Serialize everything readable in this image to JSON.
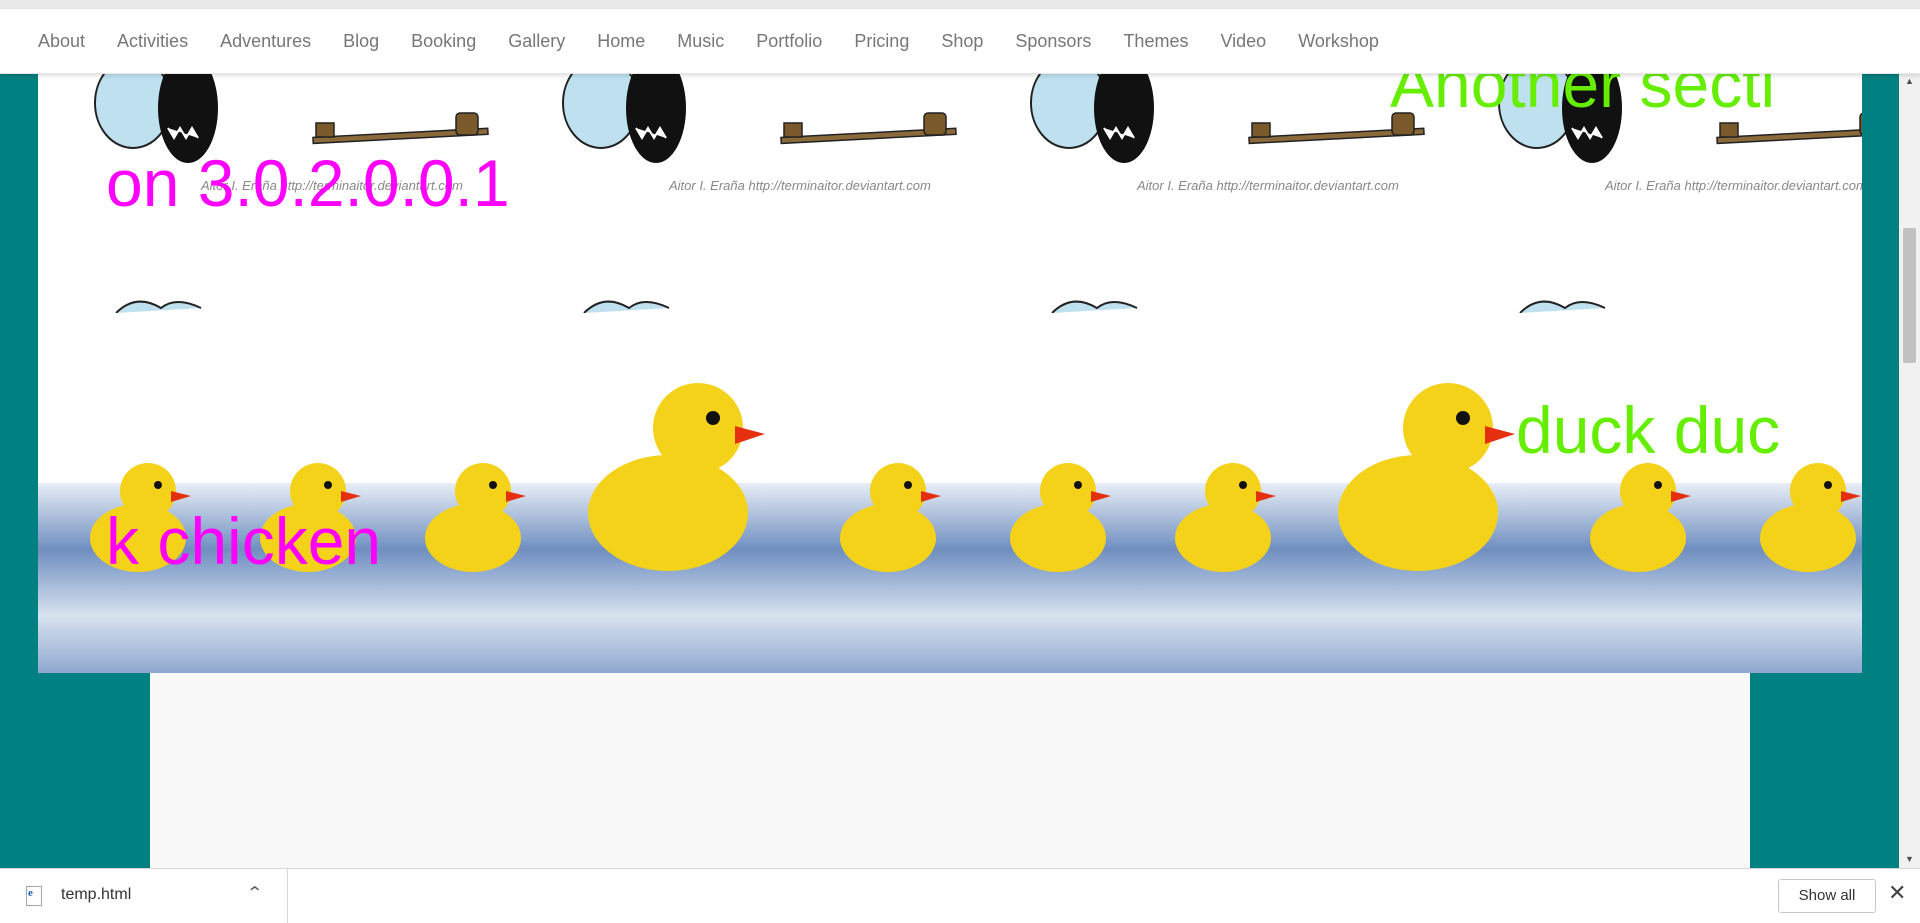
{
  "nav": {
    "items": [
      "About",
      "Activities",
      "Adventures",
      "Blog",
      "Booking",
      "Gallery",
      "Home",
      "Music",
      "Portfolio",
      "Pricing",
      "Shop",
      "Sponsors",
      "Themes",
      "Video",
      "Workshop"
    ]
  },
  "section1": {
    "watermark": "Aitor I. Eraña http://terminaitor.deviantart.com",
    "magenta_text": "on 3.0.2.0.0.1",
    "lime_text": "Another secti"
  },
  "section2": {
    "magenta_text": "k chicken",
    "lime_text": "duck duc"
  },
  "download_bar": {
    "filename": "temp.html",
    "show_all_label": "Show all"
  },
  "colors": {
    "page_background": "#008080",
    "magenta": "#ff00ff",
    "lime": "#66ee00"
  }
}
